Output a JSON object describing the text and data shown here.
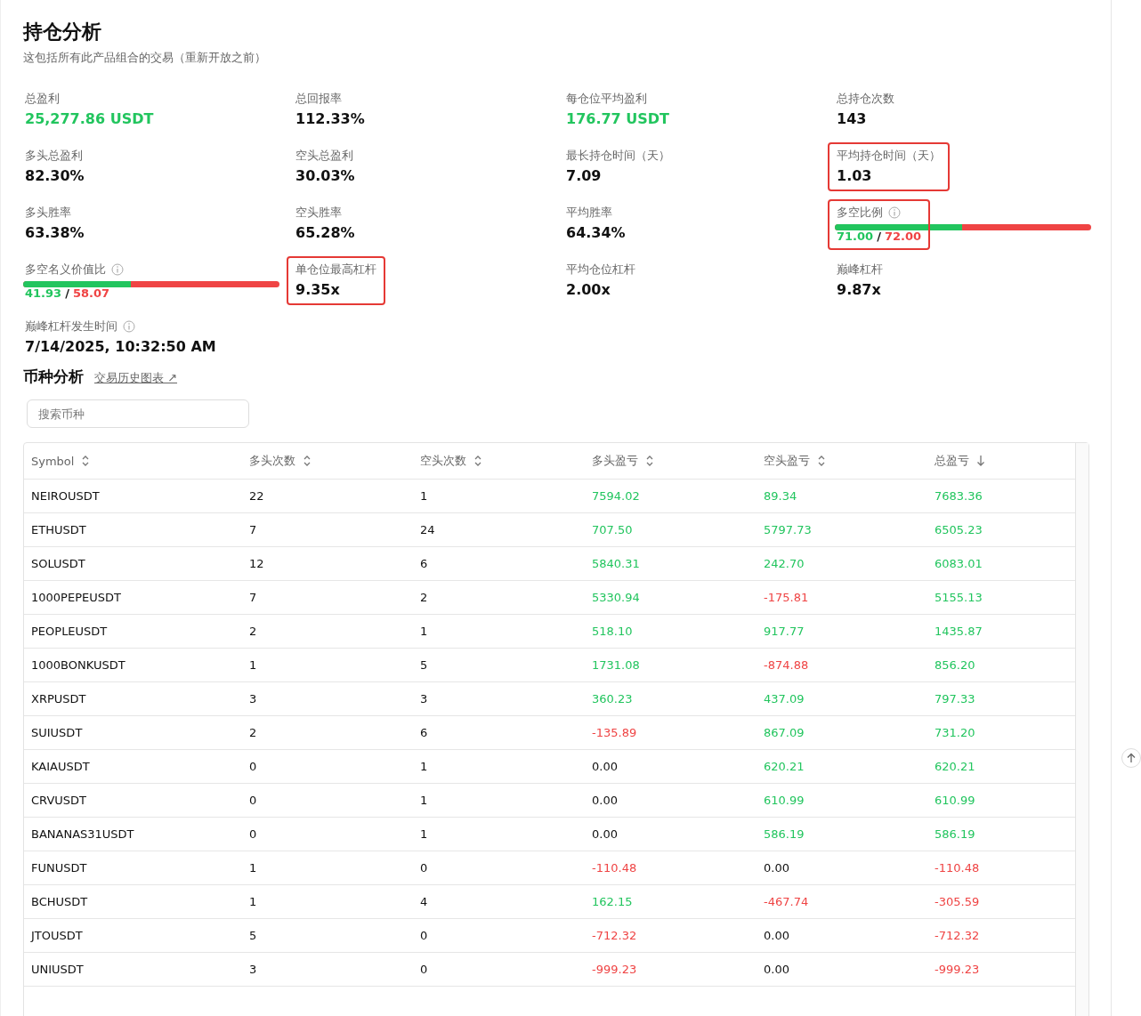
{
  "header": {
    "title": "持仓分析",
    "subtitle": "这包括所有此产品组合的交易（重新开放之前）"
  },
  "stats": [
    {
      "kind": "value",
      "label": "总盈利",
      "value": "25,277.86 USDT",
      "gain": true,
      "highlighted": false,
      "info": false
    },
    {
      "kind": "value",
      "label": "总回报率",
      "value": "112.33%",
      "gain": false,
      "highlighted": false,
      "info": false
    },
    {
      "kind": "value",
      "label": "每仓位平均盈利",
      "value": "176.77 USDT",
      "gain": true,
      "highlighted": false,
      "info": false
    },
    {
      "kind": "value",
      "label": "总持仓次数",
      "value": "143",
      "gain": false,
      "highlighted": false,
      "info": false
    },
    {
      "kind": "value",
      "label": "多头总盈利",
      "value": "82.30%",
      "gain": false,
      "highlighted": false,
      "info": false
    },
    {
      "kind": "value",
      "label": "空头总盈利",
      "value": "30.03%",
      "gain": false,
      "highlighted": false,
      "info": false
    },
    {
      "kind": "value",
      "label": "最长持仓时间（天）",
      "value": "7.09",
      "gain": false,
      "highlighted": false,
      "info": false
    },
    {
      "kind": "value",
      "label": "平均持仓时间（天）",
      "value": "1.03",
      "gain": false,
      "highlighted": true,
      "info": false
    },
    {
      "kind": "value",
      "label": "多头胜率",
      "value": "63.38%",
      "gain": false,
      "highlighted": false,
      "info": false
    },
    {
      "kind": "value",
      "label": "空头胜率",
      "value": "65.28%",
      "gain": false,
      "highlighted": false,
      "info": false
    },
    {
      "kind": "value",
      "label": "平均胜率",
      "value": "64.34%",
      "gain": false,
      "highlighted": false,
      "info": false
    },
    {
      "kind": "ratio",
      "label": "多空比例",
      "long": "71.00",
      "separator": "/",
      "short": "72.00",
      "level": 0.497,
      "highlighted": true,
      "info": true
    },
    {
      "kind": "ratio",
      "label": "多空名义价值比",
      "long": "41.93",
      "separator": "/",
      "short": "58.07",
      "level": 0.4193,
      "highlighted": false,
      "info": true
    },
    {
      "kind": "value",
      "label": "单仓位最高杠杆",
      "value": "9.35x",
      "gain": false,
      "highlighted": true,
      "info": false
    },
    {
      "kind": "value",
      "label": "平均仓位杠杆",
      "value": "2.00x",
      "gain": false,
      "highlighted": false,
      "info": false
    },
    {
      "kind": "value",
      "label": "巅峰杠杆",
      "value": "9.87x",
      "gain": false,
      "highlighted": false,
      "info": false
    },
    {
      "kind": "value",
      "label": "巅峰杠杆发生时间",
      "value": "7/14/2025, 10:32:50 AM",
      "gain": false,
      "highlighted": false,
      "info": true
    }
  ],
  "section": {
    "title": "币种分析",
    "link": "交易历史图表 ↗"
  },
  "search": {
    "placeholder": "搜索币种"
  },
  "table": {
    "columns": [
      {
        "label": "Symbol",
        "sorted": false
      },
      {
        "label": "多头次数",
        "sorted": false
      },
      {
        "label": "空头次数",
        "sorted": false
      },
      {
        "label": "多头盈亏",
        "sorted": false
      },
      {
        "label": "空头盈亏",
        "sorted": false
      },
      {
        "label": "总盈亏",
        "sorted": true
      }
    ],
    "rows": [
      {
        "symbol": "NEIROUSDT",
        "long_count": "22",
        "short_count": "1",
        "long_pnl": {
          "text": "7594.02",
          "kind": "gain"
        },
        "short_pnl": {
          "text": "89.34",
          "kind": "gain"
        },
        "total_pnl": {
          "text": "7683.36",
          "kind": "gain"
        }
      },
      {
        "symbol": "ETHUSDT",
        "long_count": "7",
        "short_count": "24",
        "long_pnl": {
          "text": "707.50",
          "kind": "gain"
        },
        "short_pnl": {
          "text": "5797.73",
          "kind": "gain"
        },
        "total_pnl": {
          "text": "6505.23",
          "kind": "gain"
        }
      },
      {
        "symbol": "SOLUSDT",
        "long_count": "12",
        "short_count": "6",
        "long_pnl": {
          "text": "5840.31",
          "kind": "gain"
        },
        "short_pnl": {
          "text": "242.70",
          "kind": "gain"
        },
        "total_pnl": {
          "text": "6083.01",
          "kind": "gain"
        }
      },
      {
        "symbol": "1000PEPEUSDT",
        "long_count": "7",
        "short_count": "2",
        "long_pnl": {
          "text": "5330.94",
          "kind": "gain"
        },
        "short_pnl": {
          "text": "-175.81",
          "kind": "loss"
        },
        "total_pnl": {
          "text": "5155.13",
          "kind": "gain"
        }
      },
      {
        "symbol": "PEOPLEUSDT",
        "long_count": "2",
        "short_count": "1",
        "long_pnl": {
          "text": "518.10",
          "kind": "gain"
        },
        "short_pnl": {
          "text": "917.77",
          "kind": "gain"
        },
        "total_pnl": {
          "text": "1435.87",
          "kind": "gain"
        }
      },
      {
        "symbol": "1000BONKUSDT",
        "long_count": "1",
        "short_count": "5",
        "long_pnl": {
          "text": "1731.08",
          "kind": "gain"
        },
        "short_pnl": {
          "text": "-874.88",
          "kind": "loss"
        },
        "total_pnl": {
          "text": "856.20",
          "kind": "gain"
        }
      },
      {
        "symbol": "XRPUSDT",
        "long_count": "3",
        "short_count": "3",
        "long_pnl": {
          "text": "360.23",
          "kind": "gain"
        },
        "short_pnl": {
          "text": "437.09",
          "kind": "gain"
        },
        "total_pnl": {
          "text": "797.33",
          "kind": "gain"
        }
      },
      {
        "symbol": "SUIUSDT",
        "long_count": "2",
        "short_count": "6",
        "long_pnl": {
          "text": "-135.89",
          "kind": "loss"
        },
        "short_pnl": {
          "text": "867.09",
          "kind": "gain"
        },
        "total_pnl": {
          "text": "731.20",
          "kind": "gain"
        }
      },
      {
        "symbol": "KAIAUSDT",
        "long_count": "0",
        "short_count": "1",
        "long_pnl": {
          "text": "0.00",
          "kind": "flat"
        },
        "short_pnl": {
          "text": "620.21",
          "kind": "gain"
        },
        "total_pnl": {
          "text": "620.21",
          "kind": "gain"
        }
      },
      {
        "symbol": "CRVUSDT",
        "long_count": "0",
        "short_count": "1",
        "long_pnl": {
          "text": "0.00",
          "kind": "flat"
        },
        "short_pnl": {
          "text": "610.99",
          "kind": "gain"
        },
        "total_pnl": {
          "text": "610.99",
          "kind": "gain"
        }
      },
      {
        "symbol": "BANANAS31USDT",
        "long_count": "0",
        "short_count": "1",
        "long_pnl": {
          "text": "0.00",
          "kind": "flat"
        },
        "short_pnl": {
          "text": "586.19",
          "kind": "gain"
        },
        "total_pnl": {
          "text": "586.19",
          "kind": "gain"
        }
      },
      {
        "symbol": "FUNUSDT",
        "long_count": "1",
        "short_count": "0",
        "long_pnl": {
          "text": "-110.48",
          "kind": "loss"
        },
        "short_pnl": {
          "text": "0.00",
          "kind": "flat"
        },
        "total_pnl": {
          "text": "-110.48",
          "kind": "loss"
        }
      },
      {
        "symbol": "BCHUSDT",
        "long_count": "1",
        "short_count": "4",
        "long_pnl": {
          "text": "162.15",
          "kind": "gain"
        },
        "short_pnl": {
          "text": "-467.74",
          "kind": "loss"
        },
        "total_pnl": {
          "text": "-305.59",
          "kind": "loss"
        }
      },
      {
        "symbol": "JTOUSDT",
        "long_count": "5",
        "short_count": "0",
        "long_pnl": {
          "text": "-712.32",
          "kind": "loss"
        },
        "short_pnl": {
          "text": "0.00",
          "kind": "flat"
        },
        "total_pnl": {
          "text": "-712.32",
          "kind": "loss"
        }
      },
      {
        "symbol": "UNIUSDT",
        "long_count": "3",
        "short_count": "0",
        "long_pnl": {
          "text": "-999.23",
          "kind": "loss"
        },
        "short_pnl": {
          "text": "0.00",
          "kind": "flat"
        },
        "total_pnl": {
          "text": "-999.23",
          "kind": "loss"
        }
      }
    ]
  }
}
